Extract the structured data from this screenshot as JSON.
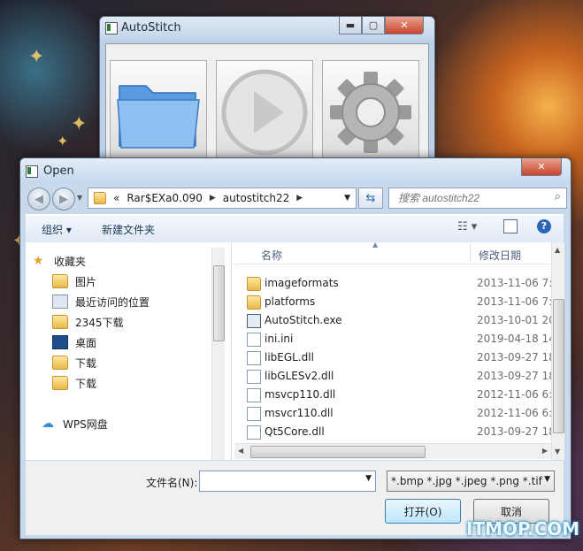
{
  "autostitch": {
    "title": "AutoStitch",
    "buttons": [
      "folder-icon",
      "play-icon",
      "gear-icon"
    ]
  },
  "dialog": {
    "title": "Open",
    "breadcrumb": {
      "prefix": "«",
      "segments": [
        "Rar$EXa0.090",
        "autostitch22"
      ]
    },
    "search_placeholder": "搜索 autostitch22",
    "toolbar": {
      "organize": "组织 ▾",
      "new_folder": "新建文件夹"
    },
    "sidebar": {
      "favorites_label": "收藏夹",
      "items": [
        "图片",
        "最近访问的位置",
        "2345下载",
        "桌面",
        "下载",
        "下载"
      ],
      "cloud_label": "WPS网盘"
    },
    "columns": {
      "name": "名称",
      "modified": "修改日期"
    },
    "files": [
      {
        "name": "imageformats",
        "date": "2013-11-06 7:1",
        "kind": "folder"
      },
      {
        "name": "platforms",
        "date": "2013-11-06 7:1",
        "kind": "folder"
      },
      {
        "name": "AutoStitch.exe",
        "date": "2013-10-01 20",
        "kind": "exe"
      },
      {
        "name": "ini.ini",
        "date": "2019-04-18 14:",
        "kind": "ini"
      },
      {
        "name": "libEGL.dll",
        "date": "2013-09-27 18:",
        "kind": "dll"
      },
      {
        "name": "libGLESv2.dll",
        "date": "2013-09-27 18:",
        "kind": "dll"
      },
      {
        "name": "msvcp110.dll",
        "date": "2012-11-06 6:2",
        "kind": "dll"
      },
      {
        "name": "msvcr110.dll",
        "date": "2012-11-06 6:2",
        "kind": "dll"
      },
      {
        "name": "Qt5Core.dll",
        "date": "2013-09-27 18:",
        "kind": "dll"
      }
    ],
    "filename_label": "文件名(N):",
    "filename_value": "",
    "filter_value": "*.bmp *.jpg *.jpeg *.png *.tif",
    "open_button": "打开(O)",
    "cancel_button": "取消"
  },
  "watermark": "ITMOP.COM"
}
